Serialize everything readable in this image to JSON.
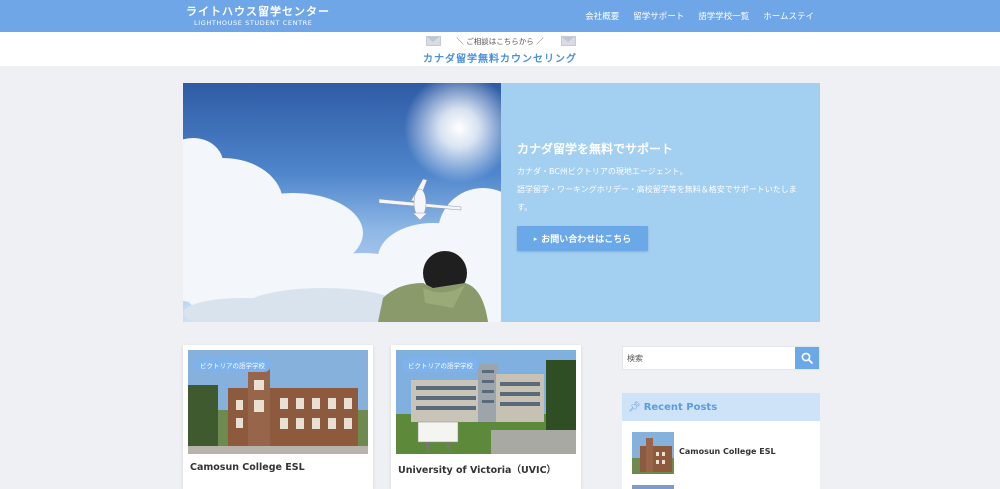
{
  "header": {
    "logo_jp": "ライトハウス留学センター",
    "logo_en": "LIGHTHOUSE STUDENT CENTRE",
    "nav": [
      "会社概要",
      "留学サポート",
      "語学学校一覧",
      "ホームステイ"
    ]
  },
  "banner": {
    "subtitle": "＼ ご相談はこちらから ／",
    "title": "カナダ留学無料カウンセリング"
  },
  "hero": {
    "title": "カナダ留学を無料でサポート",
    "text_line1": "カナダ・BC州ビクトリアの現地エージェント。",
    "text_line2": "語学留学・ワーキングホリデー・高校留学等を無料＆格安でサポートいたします。",
    "button_label": "お問い合わせはこちら"
  },
  "cards": [
    {
      "badge": "ビクトリアの語学学校",
      "title": "Camosun College ESL"
    },
    {
      "badge": "ビクトリアの語学学校",
      "title": "University of Victoria（UVIC）"
    }
  ],
  "sidebar": {
    "search_placeholder": "検索",
    "recent_title": "Recent Posts",
    "recent_items": [
      {
        "label": "Camosun College ESL"
      }
    ]
  },
  "colors": {
    "header_bg": "#6fa6e8",
    "hero_panel_bg": "#a3cff0",
    "accent": "#6aa8e8",
    "badge": "#7db2ec",
    "page_bg": "#eef0f4"
  },
  "icons": [
    "search-icon",
    "pin-icon",
    "chevron-right-icon",
    "envelope-icon"
  ]
}
